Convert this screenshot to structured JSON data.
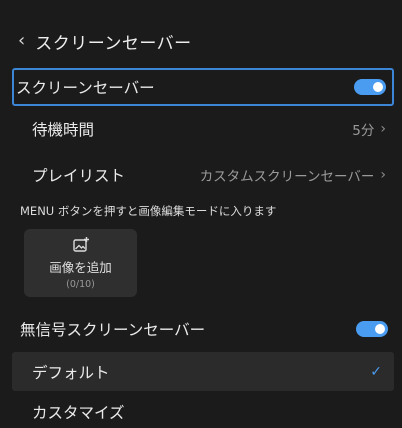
{
  "header": {
    "back_icon": "chevron-left-icon",
    "title": "スクリーンセーバー"
  },
  "screensaver": {
    "label": "スクリーンセーバー",
    "enabled": true
  },
  "wait_time": {
    "label": "待機時間",
    "value": "5分"
  },
  "playlist": {
    "label": "プレイリスト",
    "value": "カスタムスクリーンセーバー"
  },
  "hint": "MENU ボタンを押すと画像編集モードに入ります",
  "add_image": {
    "icon": "image-add-icon",
    "label": "画像を追加",
    "count": "(0/10)"
  },
  "no_signal": {
    "label": "無信号スクリーンセーバー",
    "enabled": true
  },
  "options": [
    {
      "label": "デフォルト",
      "selected": true
    },
    {
      "label": "カスタマイズ",
      "selected": false
    }
  ],
  "colors": {
    "background": "#1b1b1b",
    "accent": "#4a9cf0",
    "focus_border": "#3b86d6"
  }
}
